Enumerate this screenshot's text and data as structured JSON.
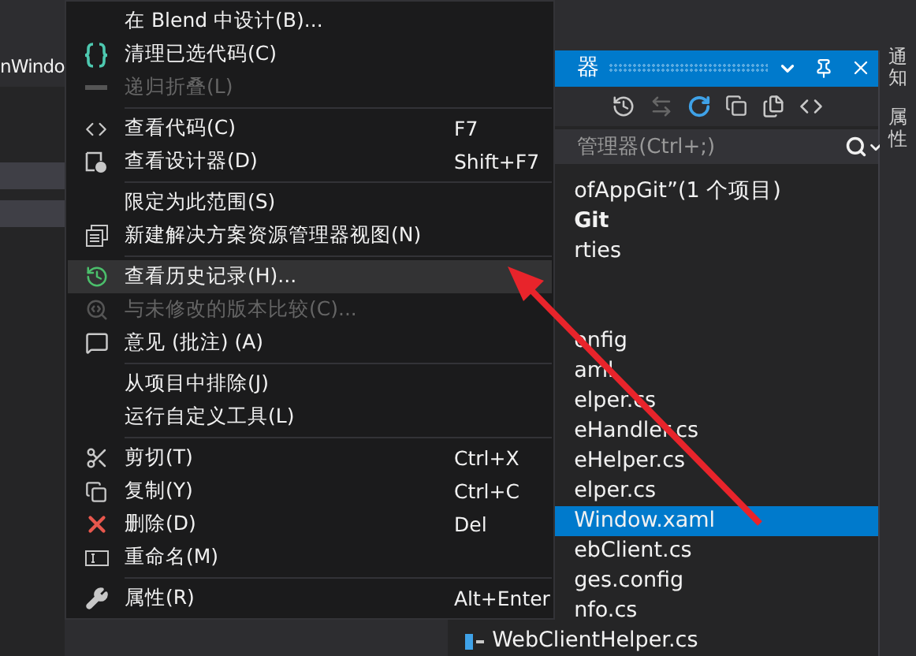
{
  "left_panel": {
    "tab_text": "nWindo"
  },
  "explorer": {
    "title": "器",
    "search": {
      "placeholder": "管理器(Ctrl+;)"
    },
    "rows": [
      {
        "label": "ofAppGit”(1 个项目)",
        "bold": false,
        "selected": false
      },
      {
        "label": "Git",
        "bold": true,
        "selected": false
      },
      {
        "label": "rties",
        "bold": false,
        "selected": false
      },
      {
        "label": "onfig",
        "bold": false,
        "selected": false
      },
      {
        "label": "aml",
        "bold": false,
        "selected": false
      },
      {
        "label": "elper.cs",
        "bold": false,
        "selected": false
      },
      {
        "label": "eHandler.cs",
        "bold": false,
        "selected": false
      },
      {
        "label": "eHelper.cs",
        "bold": false,
        "selected": false
      },
      {
        "label": "elper.cs",
        "bold": false,
        "selected": false
      },
      {
        "label": "Window.xaml",
        "bold": false,
        "selected": true
      },
      {
        "label": "ebClient.cs",
        "bold": false,
        "selected": false
      },
      {
        "label": "ges.config",
        "bold": false,
        "selected": false
      },
      {
        "label": "nfo.cs",
        "bold": false,
        "selected": false
      },
      {
        "label": "WebClientHelper.cs",
        "bold": false,
        "selected": false
      }
    ]
  },
  "side_tabs": [
    {
      "label": "通知"
    },
    {
      "label": "属性"
    }
  ],
  "context_menu": {
    "items": [
      {
        "kind": "item",
        "label": "在 Blend 中设计(B)...",
        "disabled": false,
        "selected": false
      },
      {
        "kind": "item",
        "label": "清理已选代码(C)",
        "disabled": false,
        "selected": false
      },
      {
        "kind": "item",
        "label": "递归折叠(L)",
        "disabled": true,
        "selected": false
      },
      {
        "kind": "separator"
      },
      {
        "kind": "item",
        "label": "查看代码(C)",
        "shortcut": "F7",
        "disabled": false,
        "selected": false
      },
      {
        "kind": "item",
        "label": "查看设计器(D)",
        "shortcut": "Shift+F7",
        "disabled": false,
        "selected": false
      },
      {
        "kind": "separator"
      },
      {
        "kind": "item",
        "label": "限定为此范围(S)",
        "disabled": false,
        "selected": false
      },
      {
        "kind": "item",
        "label": "新建解决方案资源管理器视图(N)",
        "disabled": false,
        "selected": false
      },
      {
        "kind": "separator"
      },
      {
        "kind": "item",
        "label": "查看历史记录(H)...",
        "disabled": false,
        "selected": true
      },
      {
        "kind": "item",
        "label": "与未修改的版本比较(C)...",
        "disabled": true,
        "selected": false
      },
      {
        "kind": "item",
        "label": "意见 (批注) (A)",
        "disabled": false,
        "selected": false
      },
      {
        "kind": "separator"
      },
      {
        "kind": "item",
        "label": "从项目中排除(J)",
        "disabled": false,
        "selected": false
      },
      {
        "kind": "item",
        "label": "运行自定义工具(L)",
        "disabled": false,
        "selected": false
      },
      {
        "kind": "separator"
      },
      {
        "kind": "item",
        "label": "剪切(T)",
        "shortcut": "Ctrl+X",
        "disabled": false,
        "selected": false
      },
      {
        "kind": "item",
        "label": "复制(Y)",
        "shortcut": "Ctrl+C",
        "disabled": false,
        "selected": false
      },
      {
        "kind": "item",
        "label": "删除(D)",
        "shortcut": "Del",
        "disabled": false,
        "selected": false
      },
      {
        "kind": "item",
        "label": "重命名(M)",
        "disabled": false,
        "selected": false
      },
      {
        "kind": "separator"
      },
      {
        "kind": "item",
        "label": "属性(R)",
        "shortcut": "Alt+Enter",
        "disabled": false,
        "selected": false
      }
    ]
  }
}
